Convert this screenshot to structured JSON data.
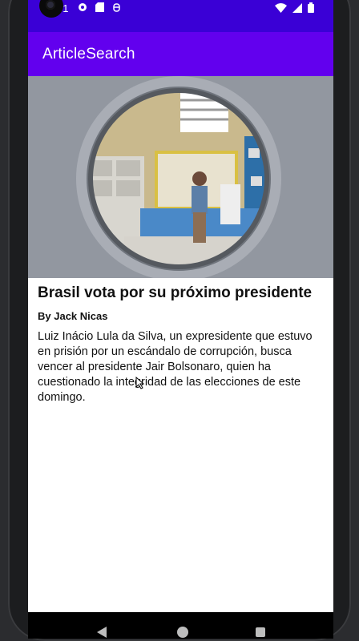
{
  "status": {
    "time": "31"
  },
  "appbar": {
    "title": "ArticleSearch"
  },
  "article": {
    "headline": "Brasil vota por su próximo presidente",
    "byline": "By Jack Nicas",
    "abstract": "Luiz Inácio Lula da Silva, un expresidente que estuvo en prisión por un escándalo de corrupción, busca vencer al presidente Jair Bolsonaro, quien ha cuestionado la integridad de las elecciones de este domingo."
  },
  "colors": {
    "status_bar": "#3a00d6",
    "app_bar": "#6200ee",
    "background": "#ffffff",
    "text": "#111111"
  },
  "icons": [
    "camera-icon",
    "message-icon",
    "sd-card-icon",
    "debug-icon",
    "wifi-icon",
    "signal-icon",
    "battery-icon",
    "back-icon",
    "home-icon",
    "recents-icon",
    "cursor-icon"
  ]
}
